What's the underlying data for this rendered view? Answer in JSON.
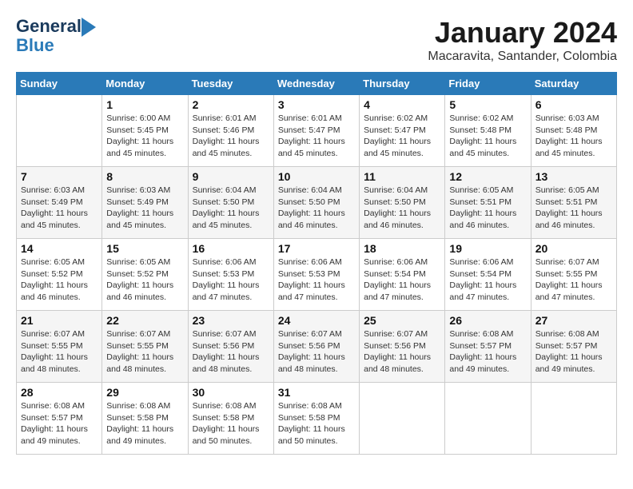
{
  "logo": {
    "general": "General",
    "blue": "Blue"
  },
  "title": "January 2024",
  "location": "Macaravita, Santander, Colombia",
  "days_of_week": [
    "Sunday",
    "Monday",
    "Tuesday",
    "Wednesday",
    "Thursday",
    "Friday",
    "Saturday"
  ],
  "weeks": [
    [
      {
        "day": "",
        "info": ""
      },
      {
        "day": "1",
        "info": "Sunrise: 6:00 AM\nSunset: 5:45 PM\nDaylight: 11 hours\nand 45 minutes."
      },
      {
        "day": "2",
        "info": "Sunrise: 6:01 AM\nSunset: 5:46 PM\nDaylight: 11 hours\nand 45 minutes."
      },
      {
        "day": "3",
        "info": "Sunrise: 6:01 AM\nSunset: 5:47 PM\nDaylight: 11 hours\nand 45 minutes."
      },
      {
        "day": "4",
        "info": "Sunrise: 6:02 AM\nSunset: 5:47 PM\nDaylight: 11 hours\nand 45 minutes."
      },
      {
        "day": "5",
        "info": "Sunrise: 6:02 AM\nSunset: 5:48 PM\nDaylight: 11 hours\nand 45 minutes."
      },
      {
        "day": "6",
        "info": "Sunrise: 6:03 AM\nSunset: 5:48 PM\nDaylight: 11 hours\nand 45 minutes."
      }
    ],
    [
      {
        "day": "7",
        "info": "Sunrise: 6:03 AM\nSunset: 5:49 PM\nDaylight: 11 hours\nand 45 minutes."
      },
      {
        "day": "8",
        "info": "Sunrise: 6:03 AM\nSunset: 5:49 PM\nDaylight: 11 hours\nand 45 minutes."
      },
      {
        "day": "9",
        "info": "Sunrise: 6:04 AM\nSunset: 5:50 PM\nDaylight: 11 hours\nand 45 minutes."
      },
      {
        "day": "10",
        "info": "Sunrise: 6:04 AM\nSunset: 5:50 PM\nDaylight: 11 hours\nand 46 minutes."
      },
      {
        "day": "11",
        "info": "Sunrise: 6:04 AM\nSunset: 5:50 PM\nDaylight: 11 hours\nand 46 minutes."
      },
      {
        "day": "12",
        "info": "Sunrise: 6:05 AM\nSunset: 5:51 PM\nDaylight: 11 hours\nand 46 minutes."
      },
      {
        "day": "13",
        "info": "Sunrise: 6:05 AM\nSunset: 5:51 PM\nDaylight: 11 hours\nand 46 minutes."
      }
    ],
    [
      {
        "day": "14",
        "info": "Sunrise: 6:05 AM\nSunset: 5:52 PM\nDaylight: 11 hours\nand 46 minutes."
      },
      {
        "day": "15",
        "info": "Sunrise: 6:05 AM\nSunset: 5:52 PM\nDaylight: 11 hours\nand 46 minutes."
      },
      {
        "day": "16",
        "info": "Sunrise: 6:06 AM\nSunset: 5:53 PM\nDaylight: 11 hours\nand 47 minutes."
      },
      {
        "day": "17",
        "info": "Sunrise: 6:06 AM\nSunset: 5:53 PM\nDaylight: 11 hours\nand 47 minutes."
      },
      {
        "day": "18",
        "info": "Sunrise: 6:06 AM\nSunset: 5:54 PM\nDaylight: 11 hours\nand 47 minutes."
      },
      {
        "day": "19",
        "info": "Sunrise: 6:06 AM\nSunset: 5:54 PM\nDaylight: 11 hours\nand 47 minutes."
      },
      {
        "day": "20",
        "info": "Sunrise: 6:07 AM\nSunset: 5:55 PM\nDaylight: 11 hours\nand 47 minutes."
      }
    ],
    [
      {
        "day": "21",
        "info": "Sunrise: 6:07 AM\nSunset: 5:55 PM\nDaylight: 11 hours\nand 48 minutes."
      },
      {
        "day": "22",
        "info": "Sunrise: 6:07 AM\nSunset: 5:55 PM\nDaylight: 11 hours\nand 48 minutes."
      },
      {
        "day": "23",
        "info": "Sunrise: 6:07 AM\nSunset: 5:56 PM\nDaylight: 11 hours\nand 48 minutes."
      },
      {
        "day": "24",
        "info": "Sunrise: 6:07 AM\nSunset: 5:56 PM\nDaylight: 11 hours\nand 48 minutes."
      },
      {
        "day": "25",
        "info": "Sunrise: 6:07 AM\nSunset: 5:56 PM\nDaylight: 11 hours\nand 48 minutes."
      },
      {
        "day": "26",
        "info": "Sunrise: 6:08 AM\nSunset: 5:57 PM\nDaylight: 11 hours\nand 49 minutes."
      },
      {
        "day": "27",
        "info": "Sunrise: 6:08 AM\nSunset: 5:57 PM\nDaylight: 11 hours\nand 49 minutes."
      }
    ],
    [
      {
        "day": "28",
        "info": "Sunrise: 6:08 AM\nSunset: 5:57 PM\nDaylight: 11 hours\nand 49 minutes."
      },
      {
        "day": "29",
        "info": "Sunrise: 6:08 AM\nSunset: 5:58 PM\nDaylight: 11 hours\nand 49 minutes."
      },
      {
        "day": "30",
        "info": "Sunrise: 6:08 AM\nSunset: 5:58 PM\nDaylight: 11 hours\nand 50 minutes."
      },
      {
        "day": "31",
        "info": "Sunrise: 6:08 AM\nSunset: 5:58 PM\nDaylight: 11 hours\nand 50 minutes."
      },
      {
        "day": "",
        "info": ""
      },
      {
        "day": "",
        "info": ""
      },
      {
        "day": "",
        "info": ""
      }
    ]
  ]
}
